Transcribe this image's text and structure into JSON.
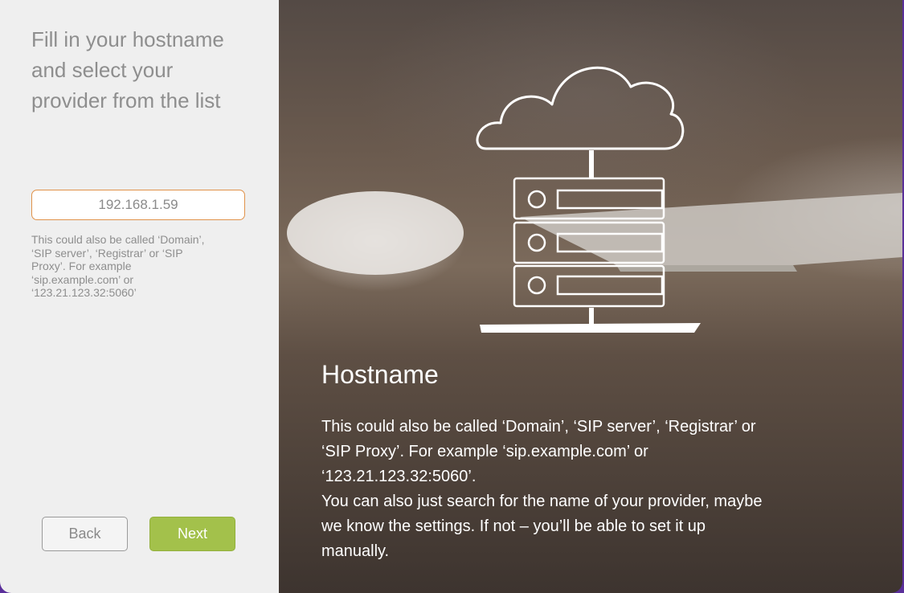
{
  "left_panel": {
    "heading": " Fill in your hostname\nand select your\nprovider from the list",
    "hostname_input": {
      "value": "192.168.1.59"
    },
    "hint": "This could also be called ‘Domain’,\n‘SIP server’, ‘Registrar’ or ‘SIP\nProxy’. For example\n‘sip.example.com’ or\n‘123.21.123.32:5060’",
    "back_label": "Back",
    "next_label": "Next"
  },
  "right_panel": {
    "title": "Hostname",
    "body": " This could also be called ‘Domain’, ‘SIP server’, ‘Registrar’ or\n‘SIP Proxy’. For example ‘sip.example.com’ or\n‘123.21.123.32:5060’.\nYou can also just search for the name of your provider, maybe\nwe know the settings. If not – you’ll be able to set it up\nmanually.",
    "illustration": "cloud-server-icon"
  },
  "colors": {
    "accent_next": "#a3c14b",
    "input_focus_border": "#e0924a",
    "left_bg": "#efefef"
  }
}
